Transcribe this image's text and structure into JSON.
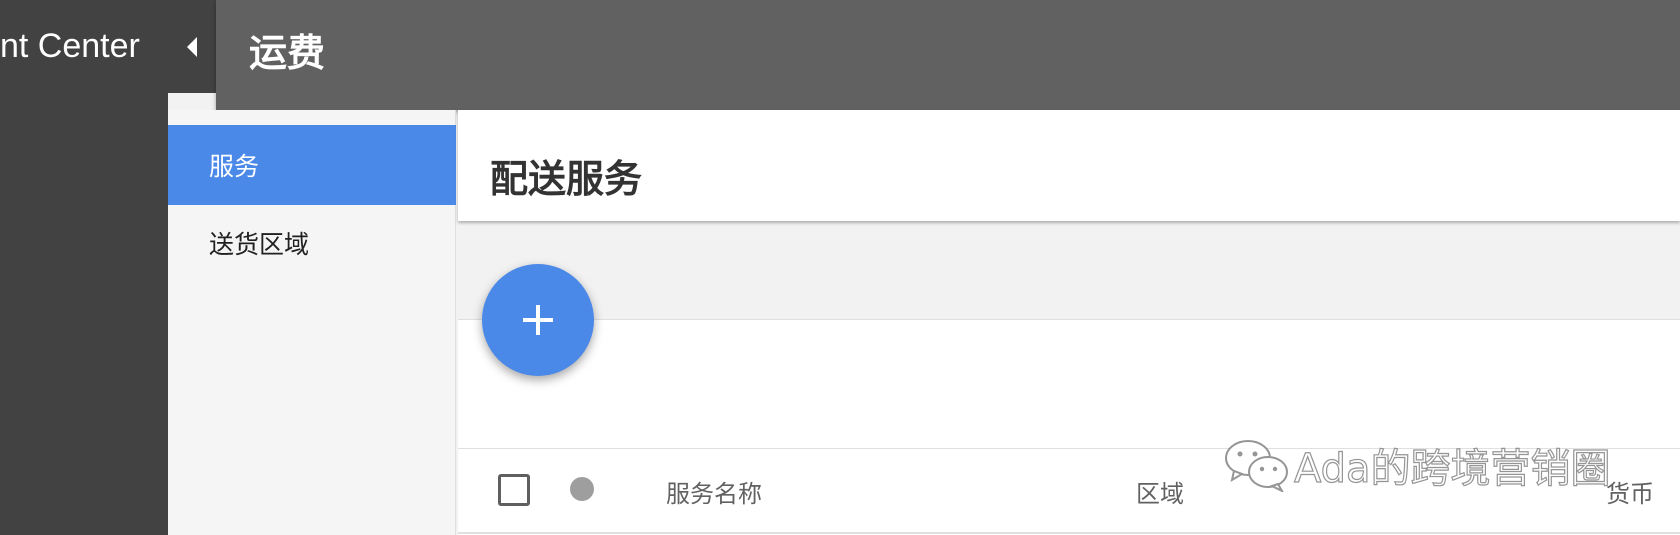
{
  "app": {
    "title_fragment": "nt Center"
  },
  "topbar": {
    "page_title": "运费"
  },
  "sidebar": {
    "items": [
      {
        "label": "服务",
        "active": true
      },
      {
        "label": "送货区域",
        "active": false
      }
    ]
  },
  "main": {
    "section_title": "配送服务",
    "fab": {
      "icon": "plus-icon"
    },
    "table": {
      "columns": [
        "服务名称",
        "区域",
        "货币"
      ]
    }
  },
  "watermark": {
    "text": "Ada的跨境营销圈",
    "icon": "wechat-icon"
  },
  "colors": {
    "accent": "#4a89e8",
    "topbar": "#616161",
    "rail": "#424242",
    "nav_bg": "#f5f5f5",
    "content_bg": "#f2f2f2"
  }
}
